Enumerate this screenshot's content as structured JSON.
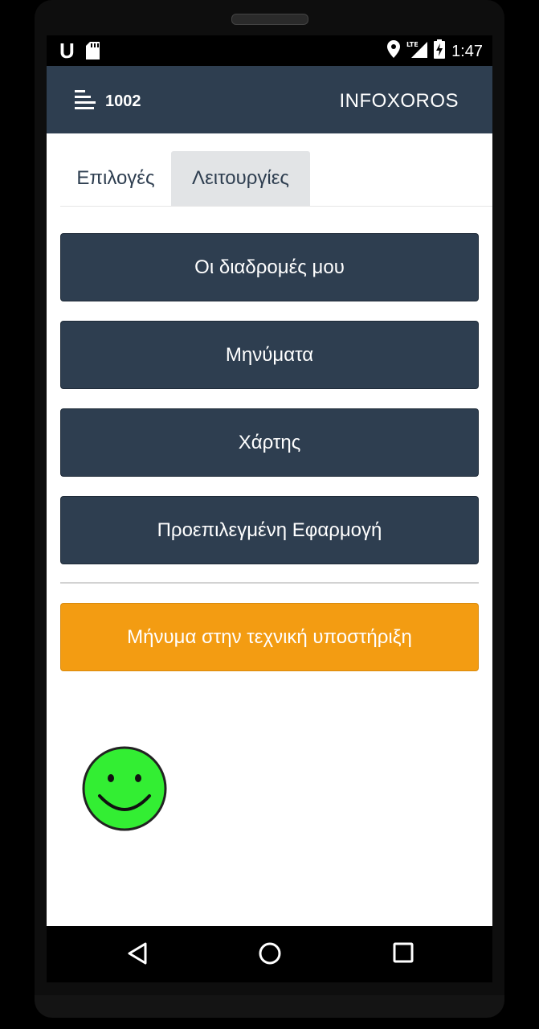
{
  "status_bar": {
    "carrier_glyph": "U",
    "time": "1:47",
    "icons": [
      "sd-card-icon",
      "location-icon",
      "lte-signal-icon",
      "battery-charging-icon"
    ]
  },
  "header": {
    "menu_icon": "menu-icon",
    "code": "1002",
    "brand": "INFOXOROS"
  },
  "tabs": [
    {
      "label": "Επιλογές",
      "active": false
    },
    {
      "label": "Λειτουργίες",
      "active": true
    }
  ],
  "buttons": [
    {
      "label": "Οι διαδρομές μου"
    },
    {
      "label": "Μηνύματα"
    },
    {
      "label": "Χάρτης"
    },
    {
      "label": "Προεπιλεγμένη Εφαρμογή"
    }
  ],
  "support_button": {
    "label": "Μήνυμα στην τεχνική υποστήριξη"
  },
  "status_indicator": {
    "icon": "smiley-face-icon",
    "color": "#33ee33"
  },
  "nav_bar": {
    "icons": [
      "back-icon",
      "home-icon",
      "recents-icon"
    ]
  },
  "colors": {
    "primary": "#2e3e50",
    "accent": "#f39c12",
    "tab_active_bg": "#e2e4e6"
  }
}
